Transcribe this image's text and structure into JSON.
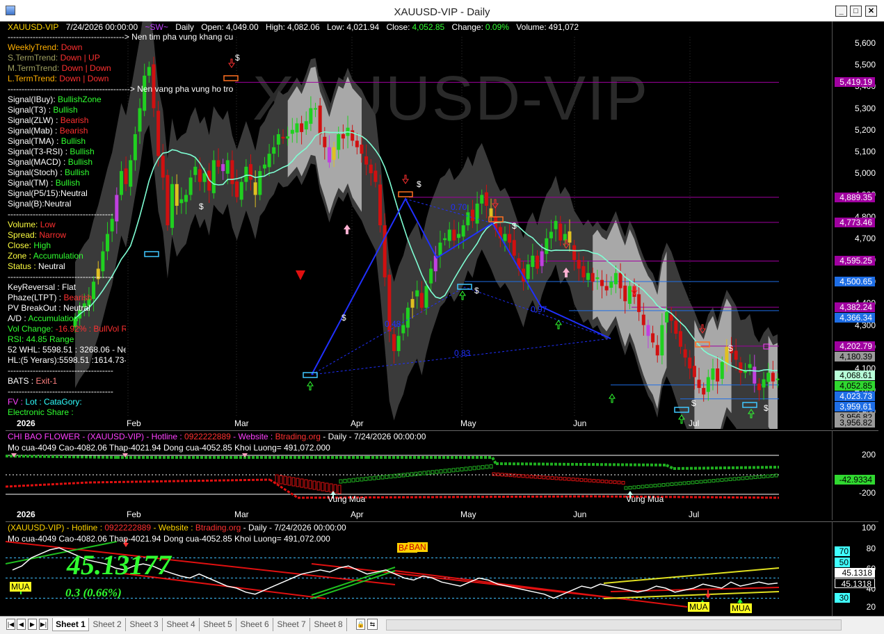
{
  "window": {
    "title": "XAUUSD-VIP  -  Daily",
    "buttons": {
      "minimize": "_",
      "restore": "□",
      "close": "✕"
    }
  },
  "main_chart": {
    "symbol": "XAUUSD-VIP",
    "datetime": "7/24/2026 00:00:00",
    "tag": "~SW~",
    "period": "Daily",
    "ohlc": {
      "open_label": "Open:",
      "open": "4,049.00",
      "high_label": "High:",
      "high": "4,082.06",
      "low_label": "Low:",
      "low": "4,021.94",
      "close_label": "Close:",
      "close": "4,052.85",
      "change_label": "Change:",
      "change": "0.09%",
      "volume_label": "Volume:",
      "volume": "491,072"
    },
    "watermark": "XAUUSD-VIP",
    "note_top": "------------------------------------------> Nen tim pha vung khang cu",
    "note_mid": "--------------------------------------------> Nen vang pha vung ho tro",
    "panel": [
      {
        "k": "WeeklyTrend: ",
        "v": "Down",
        "kc": "#ffb000",
        "vc": "#ff3030"
      },
      {
        "k": "S.TermTrend: ",
        "v": "Down | UP",
        "kc": "#a0a060",
        "vc": "#ff3030"
      },
      {
        "k": "M.TermTrend: ",
        "v": "Down | Down",
        "kc": "#a0a060",
        "vc": "#ff3030"
      },
      {
        "k": "L.TermTrend: ",
        "v": "Down | Down",
        "kc": "#ffb000",
        "vc": "#ff3030"
      },
      {
        "k": "--------------------------------------",
        "v": "",
        "kc": "#fff",
        "vc": "#fff"
      },
      {
        "k": "Signal(IBuy): ",
        "v": "BullishZone",
        "kc": "#fff",
        "vc": "#30ff30"
      },
      {
        "k": "Signal(T3)  :  ",
        "v": "Bullish",
        "kc": "#fff",
        "vc": "#30ff30"
      },
      {
        "k": "Signal(ZLW) :  ",
        "v": "Bearish",
        "kc": "#fff",
        "vc": "#ff3030"
      },
      {
        "k": "Signal(Mab) :  ",
        "v": "Bearish",
        "kc": "#fff",
        "vc": "#ff3030"
      },
      {
        "k": "Signal(TMA) :  ",
        "v": "Bullish",
        "kc": "#fff",
        "vc": "#30ff30"
      },
      {
        "k": "Signal(T3-RSI) : ",
        "v": "Bullish",
        "kc": "#fff",
        "vc": "#30ff30"
      },
      {
        "k": "Signal(MACD) : ",
        "v": "Bullish",
        "kc": "#fff",
        "vc": "#30ff30"
      },
      {
        "k": "Signal(Stoch) : ",
        "v": "Bullish",
        "kc": "#fff",
        "vc": "#30ff30"
      },
      {
        "k": "Signal(TM) : ",
        "v": "Bullish",
        "kc": "#fff",
        "vc": "#30ff30"
      },
      {
        "k": "Signal(P5/15):",
        "v": "Neutral",
        "kc": "#fff",
        "vc": "#fff"
      },
      {
        "k": "Signal(B):",
        "v": "Neutral",
        "kc": "#fff",
        "vc": "#fff"
      },
      {
        "k": "--------------------------------------",
        "v": "",
        "kc": "#fff",
        "vc": "#fff"
      },
      {
        "k": "Volume: ",
        "v": "Low",
        "kc": "#ffff40",
        "vc": "#ff3030"
      },
      {
        "k": "Spread: ",
        "v": "Narrow",
        "kc": "#ffff40",
        "vc": "#ff3030"
      },
      {
        "k": "Close: ",
        "v": "High",
        "kc": "#ffff40",
        "vc": "#30ff30"
      },
      {
        "k": "Zone : ",
        "v": "Accumulation",
        "kc": "#ffff40",
        "vc": "#30ff30"
      },
      {
        "k": "Status : ",
        "v": "Neutral",
        "kc": "#ffff40",
        "vc": "#fff"
      },
      {
        "k": "--------------------------------------",
        "v": "",
        "kc": "#fff",
        "vc": "#fff"
      },
      {
        "k": "KeyReversal : ",
        "v": "Flat",
        "kc": "#fff",
        "vc": "#fff"
      },
      {
        "k": "Phaze(LTPT) : ",
        "v": "Bearish",
        "kc": "#fff",
        "vc": "#ff3030"
      },
      {
        "k": "PV BreakOut : ",
        "v": "Neutral",
        "kc": "#fff",
        "vc": "#fff"
      },
      {
        "k": "A/D : ",
        "v": "Accumulation",
        "kc": "#fff",
        "vc": "#30ff30"
      },
      {
        "k": "Vol Change: ",
        "v": "-16.92% : BullVol Rising",
        "kc": "#30ff30",
        "vc": "#ff3030"
      },
      {
        "k": "RSI: ",
        "v": "44.85  Range",
        "kc": "#30ff30",
        "vc": "#30ff30"
      },
      {
        "k": "52 WHL: 5598.51 : 3268.06 - Neutral",
        "v": "",
        "kc": "#fff",
        "vc": "#fff"
      },
      {
        "k": "HL:(5 Yerars):5598.51 :1614.73-Neutral",
        "v": "",
        "kc": "#fff",
        "vc": "#fff"
      },
      {
        "k": "--------------------------------------",
        "v": "",
        "kc": "#fff",
        "vc": "#fff"
      },
      {
        "k": "BATS : ",
        "v": "Exit-1",
        "kc": "#fff",
        "vc": "#ff8080"
      },
      {
        "k": "--------------------------------------",
        "v": "",
        "kc": "#fff",
        "vc": "#fff"
      },
      {
        "k": "FV : ",
        "v": "Lot :  CataGory:",
        "kc": "#ff40ff",
        "vc": "#30ffff"
      },
      {
        "k": "Electronic Share :",
        "v": "",
        "kc": "#30ff30",
        "vc": "#fff"
      }
    ],
    "pattern_labels": {
      "a": "0.70",
      "b": "0.48",
      "c": "0.97",
      "d": "0.83"
    },
    "y_ticks": [
      "5,600",
      "5,500",
      "5,400",
      "5,300",
      "5,200",
      "5,100",
      "5,000",
      "4,900",
      "4,800",
      "4,700",
      "4,600",
      "4,500",
      "4,400",
      "4,300",
      "4,200",
      "4,100",
      "4,000",
      "3,900"
    ],
    "price_tags": [
      {
        "v": "5,419.19",
        "bg": "#a000a0",
        "fg": "#fff"
      },
      {
        "v": "4,889.35",
        "bg": "#a000a0",
        "fg": "#fff"
      },
      {
        "v": "4,773.46",
        "bg": "#a000a0",
        "fg": "#fff"
      },
      {
        "v": "4,595.25",
        "bg": "#a000a0",
        "fg": "#fff"
      },
      {
        "v": "4,500.65",
        "bg": "#1e6ee6",
        "fg": "#fff"
      },
      {
        "v": "4,382.24",
        "bg": "#a000a0",
        "fg": "#fff"
      },
      {
        "v": "4,366.34",
        "bg": "#1e6ee6",
        "fg": "#fff"
      },
      {
        "v": "4,202.79",
        "bg": "#a000a0",
        "fg": "#fff"
      },
      {
        "v": "4,180.39",
        "bg": "#9a9a9a",
        "fg": "#000"
      },
      {
        "v": "4,068.61",
        "bg": "#b8ffd8",
        "fg": "#000"
      },
      {
        "v": "4,052.85",
        "bg": "#30d830",
        "fg": "#000"
      },
      {
        "v": "4,023.73",
        "bg": "#1e6ee6",
        "fg": "#fff"
      },
      {
        "v": "3,959.61",
        "bg": "#1e6ee6",
        "fg": "#fff"
      },
      {
        "v": "3,956.82",
        "bg": "#9a9a9a",
        "fg": "#000"
      },
      {
        "v": "3,956.82",
        "bg": "#9a9a9a",
        "fg": "#000"
      }
    ],
    "months": [
      "2026",
      "Feb",
      "Mar",
      "Apr",
      "May",
      "Jun",
      "Jul"
    ]
  },
  "flower_pane": {
    "title": "CHI BAO FLOWER - (XAUUSD-VIP) - Hotline : ",
    "hotline": "0922222889",
    "website_label": " - Website : ",
    "website": "Btrading.org",
    "rest": " - Daily  -  7/24/2026 00:00:00",
    "line2": "Mo cua-4049  Cao-4082.06  Thap-4021.94  Dong cua-4052.85  Khoi Luong= 491,072.000",
    "zone_label": "Vung Mua",
    "y_ticks": [
      "200",
      "-200"
    ],
    "value_tag": "-42.9334",
    "months": [
      "2026",
      "Feb",
      "Mar",
      "Apr",
      "May",
      "Jun",
      "Jul"
    ]
  },
  "rsi_pane": {
    "title": "(XAUUSD-VIP) - Hotline : ",
    "hotline": "0922222889",
    "website_label": " - Website : ",
    "website": "Btrading.org",
    "rest": " - Daily  -  7/24/2026 00:00:00",
    "line2": "Mo cua-4049  Cao-4082.06  Thap-4021.94  Dong cua-4052.85  Khoi Luong= 491,072.000",
    "big_value": "45.13177",
    "change": "0.3 (0.66%)",
    "buy_label": "MUA",
    "sell_label": "BAN",
    "y_ticks": [
      "100",
      "80",
      "60",
      "40",
      "20"
    ],
    "levels": [
      "70",
      "50",
      "30"
    ],
    "value_tags": [
      "45.1318",
      "45.1318"
    ]
  },
  "sheets": {
    "tabs": [
      "Sheet 1",
      "Sheet 2",
      "Sheet 3",
      "Sheet 4",
      "Sheet 5",
      "Sheet 6",
      "Sheet 7",
      "Sheet 8"
    ],
    "active": "Sheet 1"
  },
  "colors": {
    "bull": "#30d830",
    "bear": "#e01818",
    "band": "#a0a0a0",
    "ma": "#7fffd4"
  }
}
